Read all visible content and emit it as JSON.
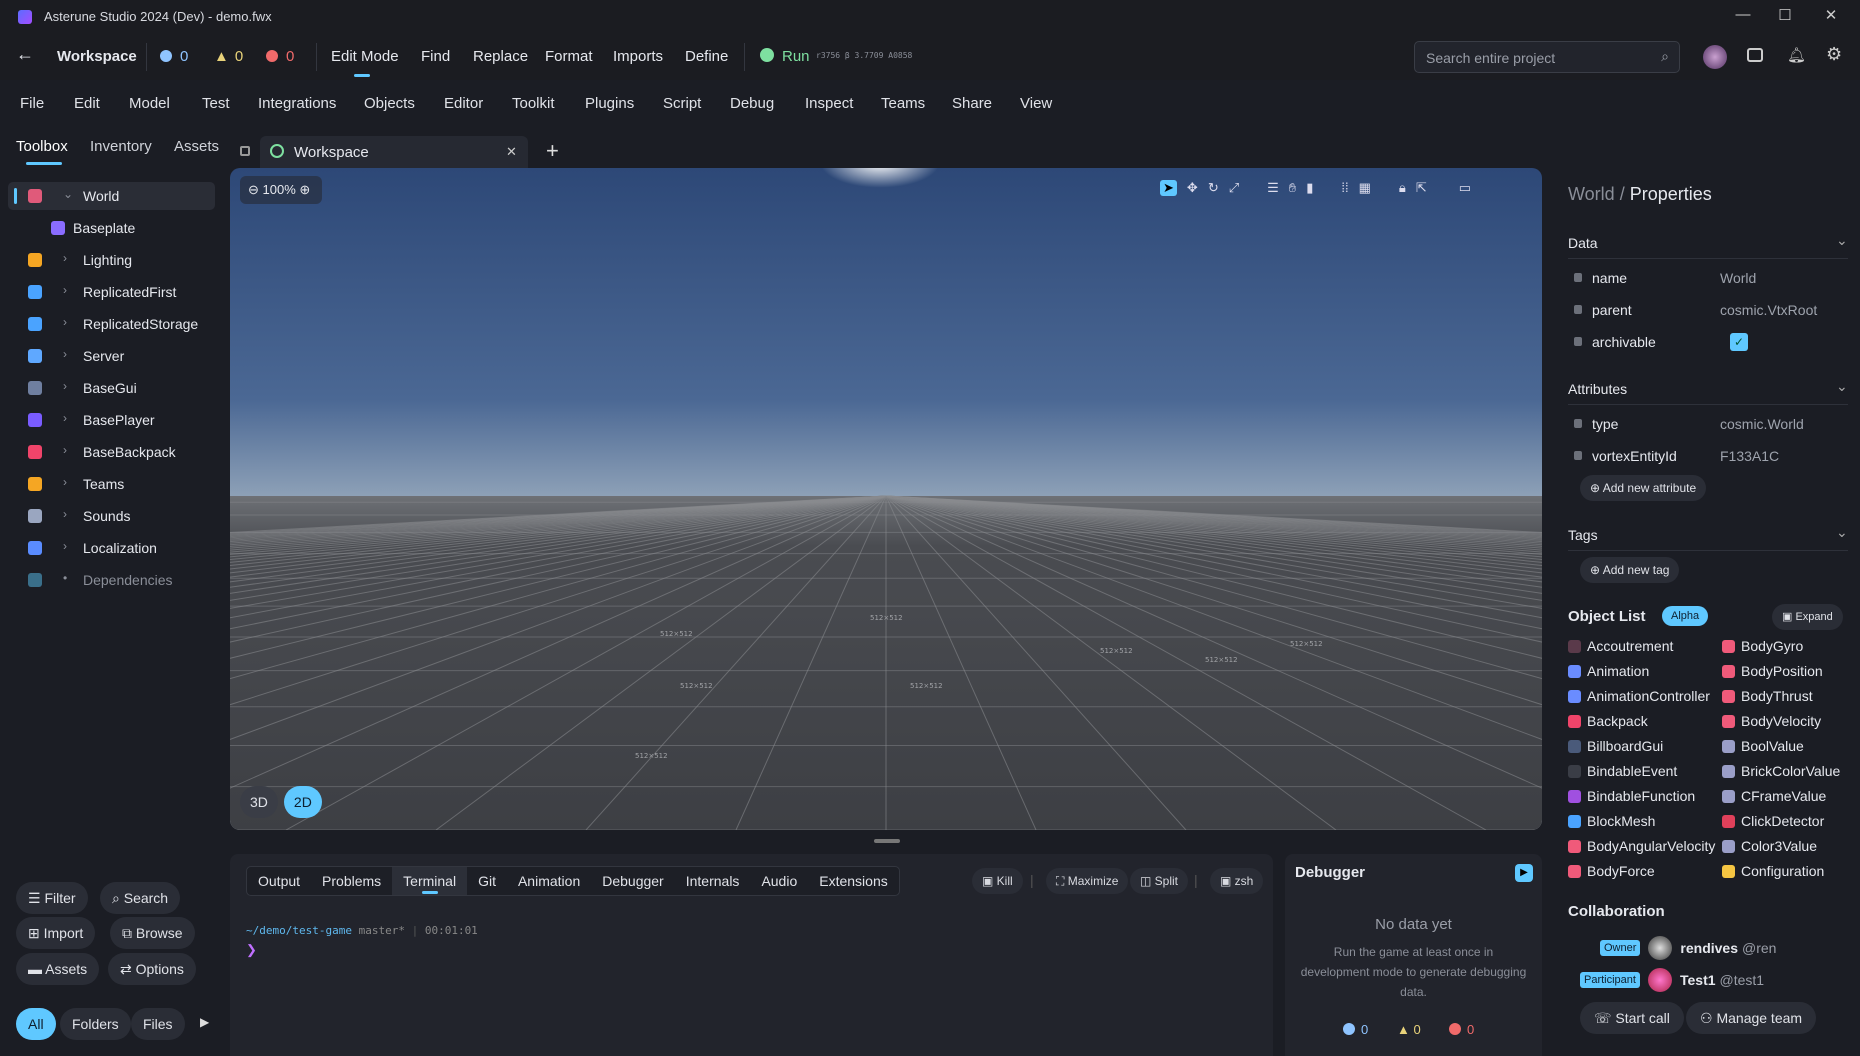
{
  "window": {
    "title": "Asterune Studio 2024 (Dev) - demo.fwx",
    "controls": [
      "—",
      "☐",
      "✕"
    ]
  },
  "toolbar": {
    "back": "←",
    "workspace": "Workspace",
    "info_count": "0",
    "warn_count": "0",
    "error_count": "0",
    "items": [
      "Edit Mode",
      "Find",
      "Replace",
      "Format",
      "Imports",
      "Define"
    ],
    "run": "Run",
    "build": "r3756 β 3.7709 A0858",
    "search_placeholder": "Search entire project",
    "search_icon": "⌕"
  },
  "menu": [
    "File",
    "Edit",
    "Model",
    "Test",
    "Integrations",
    "Objects",
    "Editor",
    "Toolkit",
    "Plugins",
    "Script",
    "Debug",
    "Inspect",
    "Teams",
    "Share",
    "View"
  ],
  "left": {
    "tabs": [
      "Toolbox",
      "Inventory",
      "Assets"
    ],
    "tree": [
      {
        "label": "World",
        "color": "#e05a7a",
        "chevron": "⌄"
      },
      {
        "label": "Baseplate",
        "color": "#8a6cff"
      },
      {
        "label": "Lighting",
        "color": "#f5a623",
        "chevron": "›"
      },
      {
        "label": "ReplicatedFirst",
        "color": "#4aa3ff",
        "chevron": "›"
      },
      {
        "label": "ReplicatedStorage",
        "color": "#4aa3ff",
        "chevron": "›"
      },
      {
        "label": "Server",
        "color": "#5fa8ff",
        "chevron": "›"
      },
      {
        "label": "BaseGui",
        "color": "#6f7fa0",
        "chevron": "›"
      },
      {
        "label": "BasePlayer",
        "color": "#7a5cff",
        "chevron": "›"
      },
      {
        "label": "BaseBackpack",
        "color": "#f0446a",
        "chevron": "›"
      },
      {
        "label": "Teams",
        "color": "#f5a623",
        "chevron": "›"
      },
      {
        "label": "Sounds",
        "color": "#9aa6c0",
        "chevron": "›"
      },
      {
        "label": "Localization",
        "color": "#5a8cff",
        "chevron": "›"
      },
      {
        "label": "Dependencies",
        "color": "#3a6f8a",
        "chevron": "•",
        "muted": true
      }
    ],
    "buttons": [
      "Filter",
      "Search",
      "Import",
      "Browse",
      "Assets",
      "Options"
    ],
    "filters": [
      "All",
      "Folders",
      "Files"
    ]
  },
  "tab": {
    "label": "Workspace",
    "close": "✕",
    "add": "+"
  },
  "viewport": {
    "zoom": "100%",
    "modes": [
      "3D",
      "2D"
    ],
    "active_mode": "2D",
    "grid_label": "512×512"
  },
  "bottom": {
    "tabs": [
      "Output",
      "Problems",
      "Terminal",
      "Git",
      "Animation",
      "Debugger",
      "Internals",
      "Audio",
      "Extensions"
    ],
    "active_tab": "Terminal",
    "actions": [
      "Kill",
      "Maximize",
      "Split",
      "zsh"
    ],
    "path": "~/demo/test-game",
    "branch": "master*",
    "time": "00:01:01",
    "prompt": "❯"
  },
  "debugger": {
    "title": "Debugger",
    "empty_title": "No data yet",
    "empty_text": "Run the game at least once in development mode to generate debugging data.",
    "info": "0",
    "warn": "0",
    "error": "0"
  },
  "properties": {
    "crumb_parent": "World",
    "crumb_sep": "/",
    "crumb_current": "Properties",
    "data_title": "Data",
    "data": [
      {
        "key": "name",
        "value": "World"
      },
      {
        "key": "parent",
        "value": "cosmic.VtxRoot"
      },
      {
        "key": "archivable",
        "value": true
      }
    ],
    "attributes_title": "Attributes",
    "attributes": [
      {
        "key": "type",
        "value": "cosmic.World"
      },
      {
        "key": "vortexEntityId",
        "value": "F133A1C"
      }
    ],
    "add_attribute": "Add new attribute",
    "tags_title": "Tags",
    "add_tag": "Add new tag"
  },
  "objects": {
    "title": "Object List",
    "badge": "Alpha",
    "expand": "Expand",
    "col1": [
      {
        "n": "Accoutrement",
        "c": "#5a3a4a"
      },
      {
        "n": "Animation",
        "c": "#6a8cff"
      },
      {
        "n": "AnimationController",
        "c": "#6a8cff"
      },
      {
        "n": "Backpack",
        "c": "#f0446a"
      },
      {
        "n": "BillboardGui",
        "c": "#4a5a7a"
      },
      {
        "n": "BindableEvent",
        "c": "#3a3d46"
      },
      {
        "n": "BindableFunction",
        "c": "#a050e0"
      },
      {
        "n": "BlockMesh",
        "c": "#4aa3ff"
      },
      {
        "n": "BodyAngularVelocity",
        "c": "#f05a7a"
      },
      {
        "n": "BodyForce",
        "c": "#f05a7a"
      }
    ],
    "col2": [
      {
        "n": "BodyGyro",
        "c": "#f05a7a"
      },
      {
        "n": "BodyPosition",
        "c": "#f05a7a"
      },
      {
        "n": "BodyThrust",
        "c": "#f05a7a"
      },
      {
        "n": "BodyVelocity",
        "c": "#f05a7a"
      },
      {
        "n": "BoolValue",
        "c": "#9a9ec8"
      },
      {
        "n": "BrickColorValue",
        "c": "#9a9ec8"
      },
      {
        "n": "CFrameValue",
        "c": "#9a9ec8"
      },
      {
        "n": "ClickDetector",
        "c": "#e0405a"
      },
      {
        "n": "Color3Value",
        "c": "#9a9ec8"
      },
      {
        "n": "Configuration",
        "c": "#f5c542"
      }
    ]
  },
  "collaboration": {
    "title": "Collaboration",
    "members": [
      {
        "role": "Owner",
        "name": "rendives",
        "handle": "@ren"
      },
      {
        "role": "Participant",
        "name": "Test1",
        "handle": "@test1"
      }
    ],
    "start_call": "Start call",
    "manage_team": "Manage team"
  },
  "colors": {
    "accent": "#5fc8ff",
    "info": "#8fc4ff",
    "warn": "#e8d27a",
    "error": "#f06a6a",
    "run": "#7ee0a0"
  }
}
